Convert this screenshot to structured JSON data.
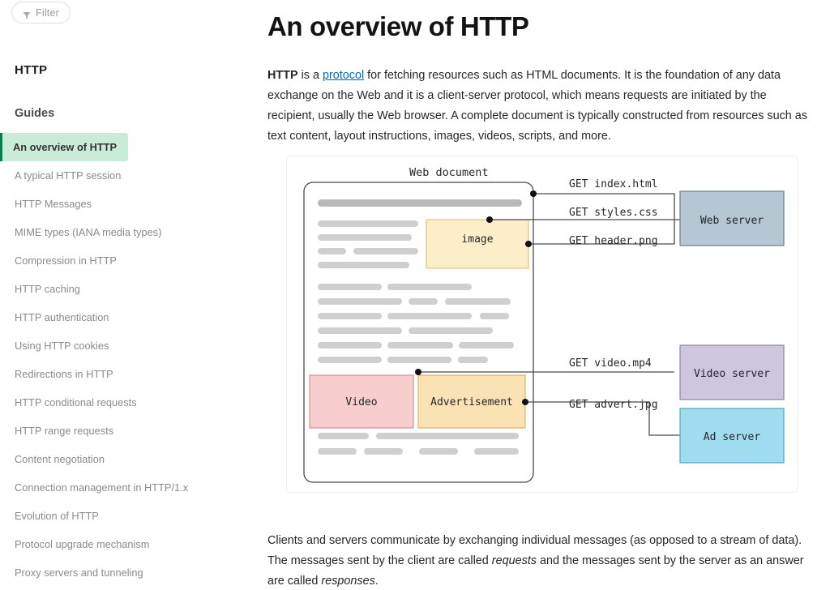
{
  "sidebar": {
    "filter": {
      "label": "Filter",
      "icon": "filter-funnel-icon"
    },
    "title": "HTTP",
    "group_label": "Guides",
    "items": [
      {
        "label": "An overview of HTTP",
        "active": true
      },
      {
        "label": "A typical HTTP session",
        "active": false
      },
      {
        "label": "HTTP Messages",
        "active": false
      },
      {
        "label": "MIME types (IANA media types)",
        "active": false
      },
      {
        "label": "Compression in HTTP",
        "active": false
      },
      {
        "label": "HTTP caching",
        "active": false
      },
      {
        "label": "HTTP authentication",
        "active": false
      },
      {
        "label": "Using HTTP cookies",
        "active": false
      },
      {
        "label": "Redirections in HTTP",
        "active": false
      },
      {
        "label": "HTTP conditional requests",
        "active": false
      },
      {
        "label": "HTTP range requests",
        "active": false
      },
      {
        "label": "Content negotiation",
        "active": false
      },
      {
        "label": "Connection management in HTTP/1.x",
        "active": false
      },
      {
        "label": "Evolution of HTTP",
        "active": false
      },
      {
        "label": "Protocol upgrade mechanism",
        "active": false
      },
      {
        "label": "Proxy servers and tunneling",
        "active": false
      }
    ],
    "scrollbar": {
      "up_arrow_icon": "scroll-up-arrow-icon"
    },
    "active_accent_color": "#007f4f",
    "active_background_color": "#c9ecd8"
  },
  "main": {
    "page_title": "An overview of HTTP",
    "paragraph1": {
      "lead": "HTTP",
      "t1": " is a ",
      "link": "protocol",
      "t2": " for fetching resources such as HTML documents. It is the foundation of any data exchange on the Web and it is a client-server protocol, which means requests are initiated by the recipient, usually the Web browser. A complete document is typically constructed from resources such as text content, layout instructions, images, videos, scripts, and more."
    },
    "paragraph2": {
      "t1": "Clients and servers communicate by exchanging individual messages (as opposed to a stream of data). The messages sent by the client are called ",
      "em1": "requests",
      "t2": " and the messages sent by the server as an answer are called ",
      "em2": "responses",
      "t3": "."
    },
    "link_color": "#0069c2"
  },
  "diagram": {
    "caption": "Web document",
    "document_blocks": [
      {
        "name": "image",
        "label": "image",
        "fill": "#fbeec8",
        "stroke": "#d9c77e"
      },
      {
        "name": "video",
        "label": "Video",
        "fill": "#f7cdcd",
        "stroke": "#d88f8f"
      },
      {
        "name": "advertisement",
        "label": "Advertisement",
        "fill": "#fbe2b4",
        "stroke": "#d9b45e"
      }
    ],
    "requests": [
      {
        "label": "GET index.html",
        "target": "Web server"
      },
      {
        "label": "GET styles.css",
        "target": "Web server"
      },
      {
        "label": "GET header.png",
        "target": "Web server"
      },
      {
        "label": "GET video.mp4",
        "target": "Video server"
      },
      {
        "label": "GET advert.jpg",
        "target": "Ad server"
      }
    ],
    "servers": [
      {
        "name": "web-server",
        "label": "Web server",
        "fill": "#b5c7d3",
        "stroke": "#6c7f8c"
      },
      {
        "name": "video-server",
        "label": "Video server",
        "fill": "#cdc6dd",
        "stroke": "#8d85a4"
      },
      {
        "name": "ad-server",
        "label": "Ad server",
        "fill": "#9fdcef",
        "stroke": "#4ea6c4"
      }
    ],
    "skeleton_color_title": "#b9b9b9",
    "skeleton_color": "#cfcfcf"
  }
}
